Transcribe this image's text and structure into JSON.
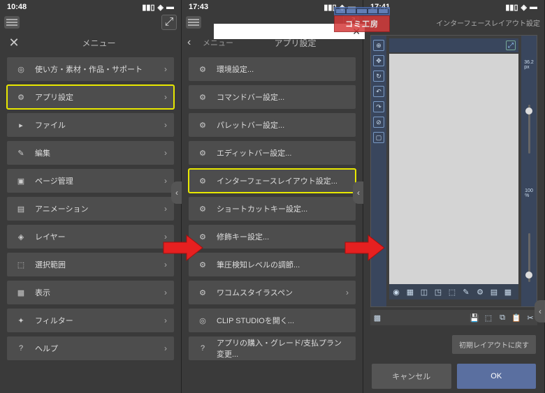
{
  "panel1": {
    "time": "10:48",
    "title": "メニュー",
    "items": [
      {
        "label": "使い方・素材・作品・サポート",
        "icon": "spiral"
      },
      {
        "label": "アプリ設定",
        "icon": "settings",
        "highlight": true
      },
      {
        "label": "ファイル",
        "icon": "file"
      },
      {
        "label": "編集",
        "icon": "edit"
      },
      {
        "label": "ページ管理",
        "icon": "pages"
      },
      {
        "label": "アニメーション",
        "icon": "film"
      },
      {
        "label": "レイヤー",
        "icon": "layers"
      },
      {
        "label": "選択範囲",
        "icon": "selection"
      },
      {
        "label": "表示",
        "icon": "grid"
      },
      {
        "label": "フィルター",
        "icon": "filter"
      },
      {
        "label": "ヘルプ",
        "icon": "help"
      }
    ]
  },
  "panel2": {
    "time": "17:43",
    "back_label": "メニュー",
    "title": "アプリ設定",
    "items": [
      {
        "label": "環境設定..."
      },
      {
        "label": "コマンドバー設定..."
      },
      {
        "label": "パレットバー設定..."
      },
      {
        "label": "エディットバー設定..."
      },
      {
        "label": "インターフェースレイアウト設定...",
        "highlight": true
      },
      {
        "label": "ショートカットキー設定..."
      },
      {
        "label": "修飾キー設定..."
      },
      {
        "label": "筆圧検知レベルの調節..."
      },
      {
        "label": "ワコムスタイラスペン",
        "chevron": true
      },
      {
        "label": "CLIP STUDIOを開く...",
        "icon": "spiral"
      },
      {
        "label": "アプリの購入・グレード/支払プラン変更...",
        "icon": "help"
      }
    ]
  },
  "panel3": {
    "time": "17:41",
    "title": "インターフェースレイアウト設定",
    "brush_size": "36.2",
    "brush_unit": "px",
    "opacity": "100",
    "opacity_unit": "%",
    "reset_label": "初期レイアウトに戻す",
    "cancel_label": "キャンセル",
    "ok_label": "OK"
  },
  "watermark": "コミ工房"
}
